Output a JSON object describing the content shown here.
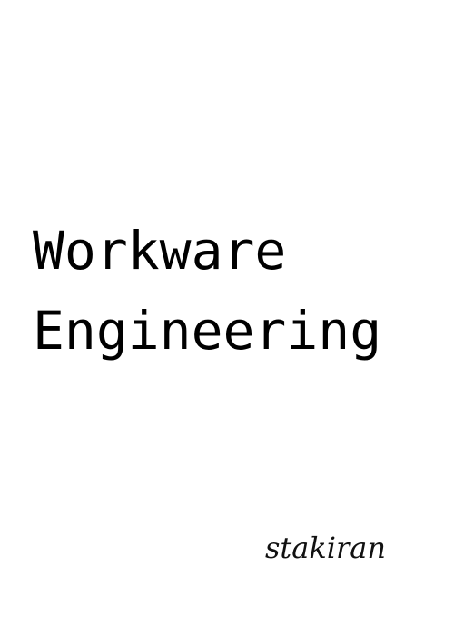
{
  "cover": {
    "title_lines": [
      "Workware",
      "Engineering"
    ],
    "author": "stakiran"
  },
  "colors": {
    "background": "#ffffff",
    "text": "#000000"
  }
}
